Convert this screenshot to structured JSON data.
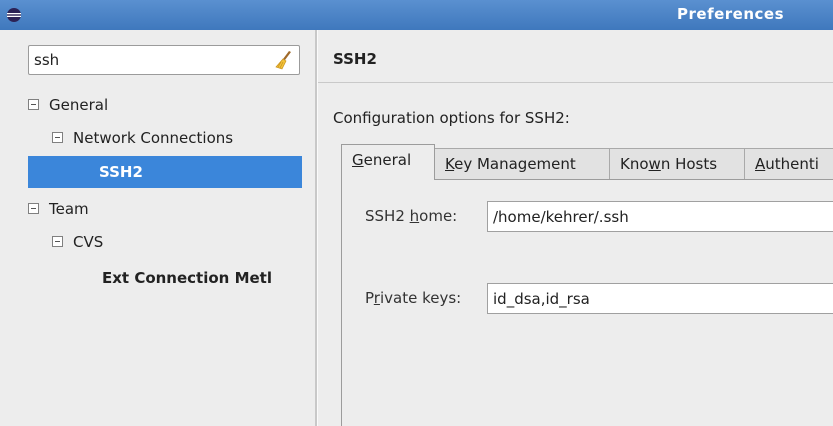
{
  "window": {
    "title": "Preferences"
  },
  "filter": {
    "value": "ssh"
  },
  "tree": {
    "general": "General",
    "network_connections": "Network Connections",
    "ssh2": "SSH2",
    "team": "Team",
    "cvs": "CVS",
    "ext_connection": "Ext Connection Metl"
  },
  "page": {
    "title": "SSH2",
    "description": "Configuration options for SSH2:"
  },
  "tabs": [
    {
      "pre": "",
      "mnemonic": "G",
      "post": "eneral"
    },
    {
      "pre": "",
      "mnemonic": "K",
      "post": "ey Management"
    },
    {
      "pre": "Kno",
      "mnemonic": "w",
      "post": "n Hosts"
    },
    {
      "pre": "",
      "mnemonic": "A",
      "post": "uthenti"
    }
  ],
  "general_tab": {
    "ssh2_home": {
      "pre": "SSH2 ",
      "mnemonic": "h",
      "post": "ome:",
      "value": "/home/kehrer/.ssh"
    },
    "private_keys": {
      "pre": "P",
      "mnemonic": "r",
      "post": "ivate keys:",
      "value": "id_dsa,id_rsa"
    }
  },
  "colors": {
    "selection": "#3b86da",
    "titlebar": "#4a82c6"
  }
}
